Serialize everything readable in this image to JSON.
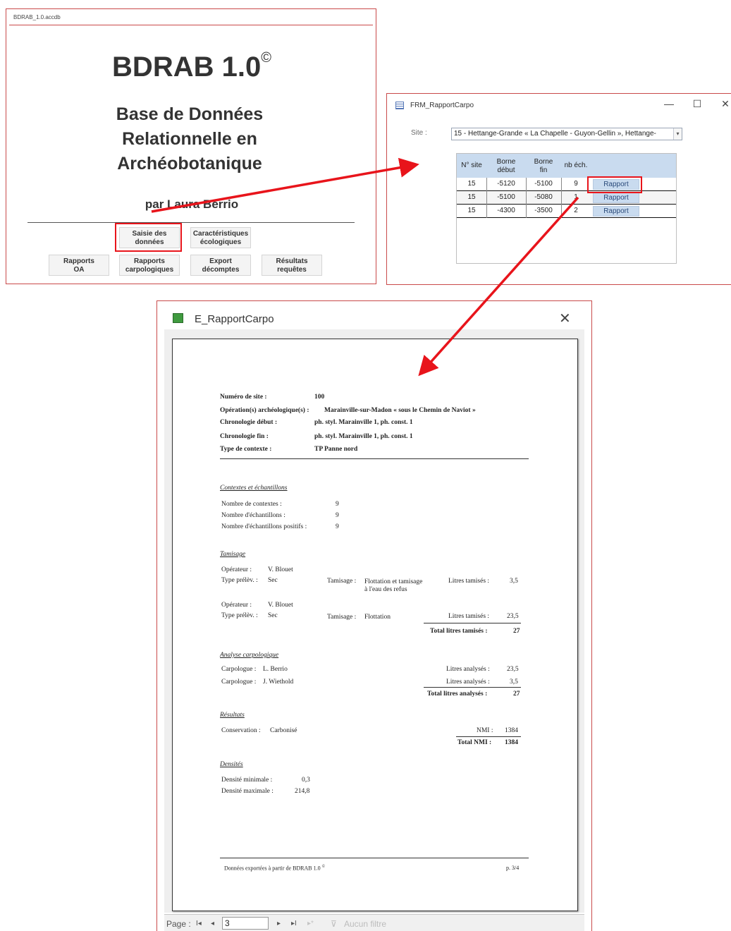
{
  "main_window": {
    "title": "BDRAB_1.0.accdb",
    "app_title": "BDRAB 1.0",
    "copyright": "©",
    "subtitle_lines": [
      "Base de Données",
      "Relationnelle en",
      "Archéobotanique"
    ],
    "author": "par Laura Berrio",
    "buttons": {
      "saisie": [
        "Saisie des",
        "données"
      ],
      "caract": [
        "Caractéristiques",
        "écologiques"
      ],
      "rapports_oa": [
        "Rapports",
        "OA"
      ],
      "rapports_carpo": [
        "Rapports",
        "carpologiques"
      ],
      "export": [
        "Export",
        "décomptes"
      ],
      "resultats": [
        "Résultats",
        "requêtes"
      ]
    }
  },
  "form_window": {
    "title": "FRM_RapportCarpo",
    "controls": {
      "minimize": "—",
      "maximize": "☐",
      "close": "✕"
    },
    "site_label": "Site :",
    "site_value": "15 - Hettange-Grande « La Chapelle - Guyon-Gellin », Hettange-",
    "dropdown_icon": "chevron-down",
    "headers": {
      "site": "N° site",
      "borne_debut": [
        "Borne",
        "début"
      ],
      "borne_fin": [
        "Borne",
        "fin"
      ],
      "nb_ech": "nb éch."
    },
    "rows": [
      {
        "site": "15",
        "debut": "-5120",
        "fin": "-5100",
        "nb": "9",
        "button": "Rapport"
      },
      {
        "site": "15",
        "debut": "-5100",
        "fin": "-5080",
        "nb": "1",
        "button": "Rapport"
      },
      {
        "site": "15",
        "debut": "-4300",
        "fin": "-3500",
        "nb": "2",
        "button": "Rapport"
      }
    ]
  },
  "report_window": {
    "title": "E_RapportCarpo",
    "close": "✕",
    "report": {
      "header": [
        {
          "label": "Numéro de site :",
          "value": "100"
        },
        {
          "label": "Opération(s) archéologique(s) :",
          "value": "Marainville-sur-Madon « sous le Chemin de Naviot »"
        },
        {
          "label": "Chronologie début :",
          "value": "ph. styl. Marainville 1, ph. const. 1"
        },
        {
          "label": "Chronologie fin :",
          "value": "ph. styl. Marainville 1, ph. const. 1"
        },
        {
          "label": "Type de contexte :",
          "value": "TP Panne nord"
        }
      ],
      "contextes": {
        "title": "Contextes et échantillons",
        "items": [
          {
            "label": "Nombre de contextes :",
            "value": "9"
          },
          {
            "label": "Nombre d'échantillons :",
            "value": "9"
          },
          {
            "label": "Nombre d'échantillons positifs :",
            "value": "9"
          }
        ]
      },
      "tamisage": {
        "title": "Tamisage",
        "op_label": "Opérateur :",
        "type_label": "Type prélèv. :",
        "tam_label": "Tamisage :",
        "litres_label": "Litres tamisés :",
        "entries": [
          {
            "operateur": "V. Blouet",
            "type": "Sec",
            "tamisage_lines": [
              "Flottation et tamisage",
              "à l'eau des refus"
            ],
            "litres": "3,5"
          },
          {
            "operateur": "V. Blouet",
            "type": "Sec",
            "tamisage_lines": [
              "Flottation"
            ],
            "litres": "23,5"
          }
        ],
        "total_label": "Total litres tamisés :",
        "total": "27"
      },
      "analyse": {
        "title": "Analyse carpologique",
        "carpologue_label": "Carpologue :",
        "litres_label": "Litres analysés :",
        "entries": [
          {
            "carpologue": "L. Berrio",
            "litres": "23,5"
          },
          {
            "carpologue": "J. Wiethold",
            "litres": "3,5"
          }
        ],
        "total_label": "Total litres analysés :",
        "total": "27"
      },
      "resultats": {
        "title": "Résultats",
        "conservation_label": "Conservation :",
        "conservation": "Carbonisé",
        "nmi_label": "NMI :",
        "nmi": "1384",
        "total_label": "Total NMI :",
        "total": "1384"
      },
      "densites": {
        "title": "Densités",
        "min_label": "Densité minimale :",
        "min": "0,3",
        "max_label": "Densité maximale :",
        "max": "214,8"
      },
      "footer_left": "Données exportées à partir de BDRAB 1.0",
      "footer_copyright": "©",
      "footer_right": "p. 3/4"
    },
    "navbar": {
      "page_label": "Page :",
      "page_value": "3",
      "first": "I◂",
      "prev": "◂",
      "next": "▸",
      "last": "▸I",
      "new": "▸*",
      "filter_label": "Aucun filtre"
    }
  },
  "colors": {
    "annotation": "#e8141b",
    "grid_header": "#c9dbef",
    "window_border": "#c94a4a"
  }
}
